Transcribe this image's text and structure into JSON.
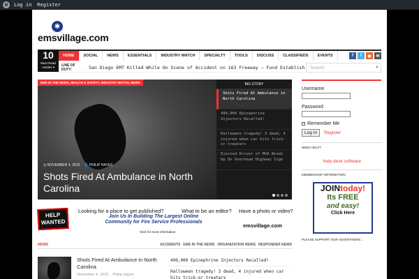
{
  "adminbar": {
    "login": "Log in",
    "register": "Register"
  },
  "site": {
    "logo_text": "emsvillage.com"
  },
  "must_read": {
    "count": "10",
    "label": "Must Read Articles ▾"
  },
  "nav": {
    "items": [
      "HOME",
      "SOCIAL",
      "NEWS",
      "ESSENTIALS",
      "INDUSTRY WATCH",
      "SPECIALTY",
      "TOOLS",
      "DISCUSS",
      "CLASSIFIEDS",
      "EVENTS"
    ]
  },
  "social_colors": {
    "facebook": "#3b5998",
    "twitter": "#55acee",
    "rss": "#f26522",
    "email": "#555555"
  },
  "ticker": {
    "label": "LINE OF DUTY:",
    "text": "San Diego EMT Killed While On Scene of Accident on 163 Freeway — Fund Established"
  },
  "search": {
    "placeholder": "Search"
  },
  "hero": {
    "categories": "EMS IN THE NEWS, HEALTH & SAFETY, INDUSTRY WATCH, NEWS",
    "date": "NOVEMBER 4, 2015",
    "author": "PHILIP HAYES",
    "title": "Shots Fired At Ambulance in North Carolina"
  },
  "big_story": {
    "header": "BIG STORY",
    "items": [
      "Shots Fired At Ambulance in North Carolina",
      "490,000 Epinephrine Injectors Recalled!",
      "Halloween tragedy! 3 dead, 4 injured when car hits trick-or-treaters",
      "Ejected Driver of MVA Winds Up On Overhead Highway Sign"
    ]
  },
  "login": {
    "username_label": "Username",
    "password_label": "Password",
    "remember_label": "Remember Me",
    "login_button": "Log In",
    "register_link": "Register"
  },
  "sidebar": {
    "need_help": "NEED HELP?",
    "help_desk": "help desk software",
    "membership": "MEMBERSHIP INFORMATION",
    "join_1": "JOIN",
    "join_2": "today!",
    "join_3": "Its FREE",
    "join_4": "and easy!",
    "join_5": "Click Here",
    "ads": "PLEASE SUPPORT OUR ADVERTISERS..."
  },
  "banner": {
    "help": "HELP",
    "wanted": "WANTED",
    "q1": "Looking for a place to get published?",
    "q2": "What to be an editor?",
    "q3": "Have a photo or video?",
    "mid": "Join Us In Building The Largest Online Community for Fire Service Professionals",
    "small": "Click for more information",
    "logo": "emsvillage.com"
  },
  "news": {
    "label": "NEWS",
    "tabs": [
      "ACCIDENTS",
      "EMS IN THE NEWS",
      "ORGANIZATION NEWS",
      "RESPONDER NEWS"
    ],
    "post_title": "Shots Fired At Ambulance in North Carolina",
    "post_date": "November 4, 2015",
    "post_author": "Philip Hayes",
    "list": [
      "490,000 Epinephrine Injectors Recalled!",
      "Halloween tragedy! 3 dead, 4 injured when car hits trick-or-treaters"
    ]
  }
}
